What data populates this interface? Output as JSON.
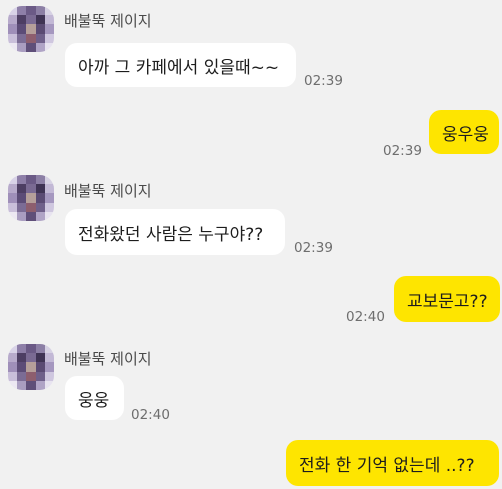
{
  "conversation": {
    "sender_name": "배불뚝 제이지",
    "messages": [
      {
        "side": "in",
        "text": "아까 그 카페에서 있을때~~",
        "time": "02:39"
      },
      {
        "side": "out",
        "text": "웅우웅",
        "time": "02:39"
      },
      {
        "side": "in",
        "text": "전화왔던 사람은 누구야??",
        "time": "02:39"
      },
      {
        "side": "out",
        "text": "교보문고??",
        "time": "02:40"
      },
      {
        "side": "in",
        "text": "웅웅",
        "time": "02:40"
      },
      {
        "side": "out",
        "text": "전화 한 기억 없는데 ..??",
        "time": ""
      }
    ]
  },
  "colors": {
    "background": "#f1f1f1",
    "incoming_bubble": "#ffffff",
    "outgoing_bubble": "#fee500",
    "time_text": "#6e6e6e"
  },
  "icons": {
    "profile_avatar": "pixelated-profile-avatar-icon"
  }
}
